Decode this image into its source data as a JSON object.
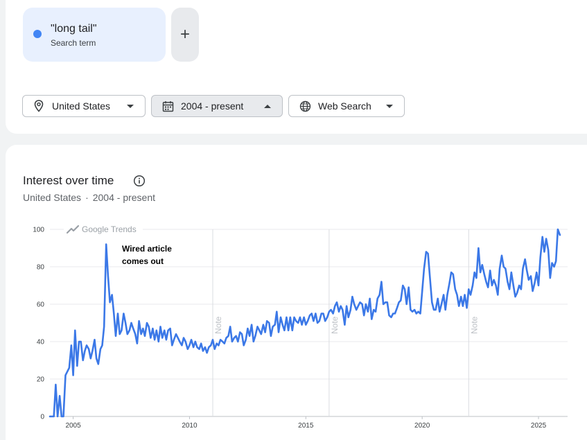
{
  "compare": {
    "term": "\"long tail\"",
    "term_type": "Search term",
    "term_color": "#4285f4",
    "add_label": "+"
  },
  "filters": {
    "region": "United States",
    "time": "2004 - present",
    "property": "Web Search",
    "icons": [
      "location-pin-icon",
      "calendar-icon",
      "globe-icon"
    ]
  },
  "panel": {
    "title": "Interest over time",
    "subtitle_region": "United States",
    "subtitle_sep": "·",
    "subtitle_time": "2004 - present",
    "watermark": "Google Trends"
  },
  "chart_data": {
    "type": "line",
    "xlabel": "",
    "ylabel": "",
    "ylim": [
      0,
      100
    ],
    "yticks": [
      0,
      20,
      40,
      60,
      80,
      100
    ],
    "xticks": [
      2005,
      2010,
      2015,
      2020,
      2025
    ],
    "xlim": [
      2004.0,
      2026.25
    ],
    "line_color": "#3b78e7",
    "grid": true,
    "notes": [
      {
        "x": 2011.0,
        "label": "Note"
      },
      {
        "x": 2016.0,
        "label": "Note"
      },
      {
        "x": 2022.0,
        "label": "Note"
      }
    ],
    "annotation": {
      "lines": [
        "Wired article",
        "comes out"
      ],
      "x": 2006.5
    },
    "series": [
      {
        "values": [
          [
            2004.0,
            0
          ],
          [
            2004.17,
            0
          ],
          [
            2004.25,
            17
          ],
          [
            2004.33,
            0
          ],
          [
            2004.42,
            11
          ],
          [
            2004.5,
            0
          ],
          [
            2004.58,
            0
          ],
          [
            2004.67,
            22
          ],
          [
            2004.75,
            24
          ],
          [
            2004.83,
            26
          ],
          [
            2004.92,
            38
          ],
          [
            2005.0,
            22
          ],
          [
            2005.08,
            46
          ],
          [
            2005.17,
            27
          ],
          [
            2005.25,
            40
          ],
          [
            2005.33,
            40
          ],
          [
            2005.42,
            30
          ],
          [
            2005.5,
            35
          ],
          [
            2005.58,
            38
          ],
          [
            2005.67,
            36
          ],
          [
            2005.75,
            31
          ],
          [
            2005.83,
            35
          ],
          [
            2005.92,
            41
          ],
          [
            2006.0,
            31
          ],
          [
            2006.08,
            28
          ],
          [
            2006.17,
            36
          ],
          [
            2006.25,
            38
          ],
          [
            2006.33,
            48
          ],
          [
            2006.42,
            92
          ],
          [
            2006.5,
            75
          ],
          [
            2006.58,
            61
          ],
          [
            2006.67,
            65
          ],
          [
            2006.75,
            55
          ],
          [
            2006.83,
            43
          ],
          [
            2006.92,
            55
          ],
          [
            2007.0,
            44
          ],
          [
            2007.08,
            46
          ],
          [
            2007.17,
            55
          ],
          [
            2007.25,
            50
          ],
          [
            2007.33,
            44
          ],
          [
            2007.42,
            46
          ],
          [
            2007.5,
            50
          ],
          [
            2007.58,
            47
          ],
          [
            2007.67,
            44
          ],
          [
            2007.75,
            39
          ],
          [
            2007.83,
            51
          ],
          [
            2007.92,
            44
          ],
          [
            2008.0,
            47
          ],
          [
            2008.08,
            43
          ],
          [
            2008.17,
            50
          ],
          [
            2008.25,
            48
          ],
          [
            2008.33,
            42
          ],
          [
            2008.42,
            47
          ],
          [
            2008.5,
            41
          ],
          [
            2008.58,
            46
          ],
          [
            2008.67,
            40
          ],
          [
            2008.75,
            48
          ],
          [
            2008.83,
            42
          ],
          [
            2008.92,
            46
          ],
          [
            2009.0,
            41
          ],
          [
            2009.08,
            46
          ],
          [
            2009.17,
            47
          ],
          [
            2009.25,
            38
          ],
          [
            2009.33,
            41
          ],
          [
            2009.42,
            44
          ],
          [
            2009.5,
            42
          ],
          [
            2009.58,
            40
          ],
          [
            2009.67,
            38
          ],
          [
            2009.75,
            42
          ],
          [
            2009.83,
            40
          ],
          [
            2009.92,
            36
          ],
          [
            2010.0,
            38
          ],
          [
            2010.08,
            41
          ],
          [
            2010.17,
            37
          ],
          [
            2010.25,
            40
          ],
          [
            2010.33,
            37
          ],
          [
            2010.42,
            36
          ],
          [
            2010.5,
            39
          ],
          [
            2010.58,
            35
          ],
          [
            2010.67,
            37
          ],
          [
            2010.75,
            34
          ],
          [
            2010.83,
            37
          ],
          [
            2010.92,
            38
          ],
          [
            2011.0,
            41
          ],
          [
            2011.08,
            36
          ],
          [
            2011.17,
            39
          ],
          [
            2011.25,
            38
          ],
          [
            2011.33,
            41
          ],
          [
            2011.42,
            40
          ],
          [
            2011.5,
            39
          ],
          [
            2011.58,
            42
          ],
          [
            2011.67,
            43
          ],
          [
            2011.75,
            48
          ],
          [
            2011.83,
            40
          ],
          [
            2011.92,
            42
          ],
          [
            2012.0,
            43
          ],
          [
            2012.08,
            40
          ],
          [
            2012.17,
            45
          ],
          [
            2012.25,
            44
          ],
          [
            2012.33,
            38
          ],
          [
            2012.42,
            41
          ],
          [
            2012.5,
            47
          ],
          [
            2012.58,
            43
          ],
          [
            2012.67,
            49
          ],
          [
            2012.75,
            40
          ],
          [
            2012.83,
            43
          ],
          [
            2012.92,
            48
          ],
          [
            2013.0,
            46
          ],
          [
            2013.08,
            44
          ],
          [
            2013.17,
            49
          ],
          [
            2013.25,
            45
          ],
          [
            2013.33,
            51
          ],
          [
            2013.42,
            50
          ],
          [
            2013.5,
            43
          ],
          [
            2013.58,
            48
          ],
          [
            2013.67,
            49
          ],
          [
            2013.75,
            56
          ],
          [
            2013.83,
            45
          ],
          [
            2013.92,
            53
          ],
          [
            2014.0,
            49
          ],
          [
            2014.08,
            46
          ],
          [
            2014.17,
            53
          ],
          [
            2014.25,
            46
          ],
          [
            2014.33,
            53
          ],
          [
            2014.42,
            46
          ],
          [
            2014.5,
            53
          ],
          [
            2014.58,
            51
          ],
          [
            2014.67,
            50
          ],
          [
            2014.75,
            53
          ],
          [
            2014.83,
            49
          ],
          [
            2014.92,
            53
          ],
          [
            2015.0,
            49
          ],
          [
            2015.08,
            51
          ],
          [
            2015.17,
            54
          ],
          [
            2015.25,
            55
          ],
          [
            2015.33,
            51
          ],
          [
            2015.42,
            55
          ],
          [
            2015.5,
            50
          ],
          [
            2015.58,
            51
          ],
          [
            2015.67,
            55
          ],
          [
            2015.75,
            55
          ],
          [
            2015.83,
            51
          ],
          [
            2015.92,
            53
          ],
          [
            2016.0,
            56
          ],
          [
            2016.08,
            57
          ],
          [
            2016.17,
            55
          ],
          [
            2016.25,
            59
          ],
          [
            2016.33,
            61
          ],
          [
            2016.42,
            56
          ],
          [
            2016.5,
            59
          ],
          [
            2016.58,
            57
          ],
          [
            2016.67,
            49
          ],
          [
            2016.75,
            59
          ],
          [
            2016.83,
            53
          ],
          [
            2016.92,
            57
          ],
          [
            2017.0,
            64
          ],
          [
            2017.08,
            60
          ],
          [
            2017.17,
            57
          ],
          [
            2017.25,
            59
          ],
          [
            2017.33,
            61
          ],
          [
            2017.42,
            60
          ],
          [
            2017.5,
            54
          ],
          [
            2017.58,
            60
          ],
          [
            2017.67,
            56
          ],
          [
            2017.75,
            63
          ],
          [
            2017.83,
            52
          ],
          [
            2017.92,
            57
          ],
          [
            2018.0,
            56
          ],
          [
            2018.08,
            63
          ],
          [
            2018.17,
            65
          ],
          [
            2018.25,
            72
          ],
          [
            2018.33,
            60
          ],
          [
            2018.42,
            61
          ],
          [
            2018.5,
            61
          ],
          [
            2018.58,
            54
          ],
          [
            2018.67,
            53
          ],
          [
            2018.75,
            55
          ],
          [
            2018.83,
            55
          ],
          [
            2018.92,
            58
          ],
          [
            2019.0,
            61
          ],
          [
            2019.08,
            62
          ],
          [
            2019.17,
            70
          ],
          [
            2019.25,
            68
          ],
          [
            2019.33,
            60
          ],
          [
            2019.42,
            69
          ],
          [
            2019.5,
            57
          ],
          [
            2019.58,
            56
          ],
          [
            2019.67,
            57
          ],
          [
            2019.75,
            55
          ],
          [
            2019.83,
            56
          ],
          [
            2019.92,
            55
          ],
          [
            2020.0,
            67
          ],
          [
            2020.08,
            79
          ],
          [
            2020.17,
            88
          ],
          [
            2020.25,
            87
          ],
          [
            2020.33,
            75
          ],
          [
            2020.42,
            61
          ],
          [
            2020.5,
            57
          ],
          [
            2020.58,
            57
          ],
          [
            2020.67,
            63
          ],
          [
            2020.75,
            56
          ],
          [
            2020.83,
            60
          ],
          [
            2020.92,
            65
          ],
          [
            2021.0,
            57
          ],
          [
            2021.08,
            65
          ],
          [
            2021.17,
            71
          ],
          [
            2021.25,
            77
          ],
          [
            2021.33,
            76
          ],
          [
            2021.42,
            68
          ],
          [
            2021.5,
            65
          ],
          [
            2021.58,
            59
          ],
          [
            2021.67,
            64
          ],
          [
            2021.75,
            59
          ],
          [
            2021.83,
            65
          ],
          [
            2021.92,
            58
          ],
          [
            2022.0,
            68
          ],
          [
            2022.08,
            65
          ],
          [
            2022.17,
            70
          ],
          [
            2022.25,
            77
          ],
          [
            2022.33,
            74
          ],
          [
            2022.42,
            90
          ],
          [
            2022.5,
            77
          ],
          [
            2022.58,
            81
          ],
          [
            2022.67,
            76
          ],
          [
            2022.75,
            72
          ],
          [
            2022.83,
            69
          ],
          [
            2022.92,
            78
          ],
          [
            2023.0,
            70
          ],
          [
            2023.08,
            73
          ],
          [
            2023.17,
            70
          ],
          [
            2023.25,
            65
          ],
          [
            2023.33,
            79
          ],
          [
            2023.42,
            86
          ],
          [
            2023.5,
            80
          ],
          [
            2023.58,
            79
          ],
          [
            2023.67,
            72
          ],
          [
            2023.75,
            68
          ],
          [
            2023.83,
            77
          ],
          [
            2023.92,
            70
          ],
          [
            2024.0,
            64
          ],
          [
            2024.08,
            66
          ],
          [
            2024.17,
            70
          ],
          [
            2024.25,
            68
          ],
          [
            2024.33,
            79
          ],
          [
            2024.42,
            84
          ],
          [
            2024.5,
            78
          ],
          [
            2024.58,
            73
          ],
          [
            2024.67,
            75
          ],
          [
            2024.75,
            67
          ],
          [
            2024.83,
            71
          ],
          [
            2024.92,
            77
          ],
          [
            2025.0,
            70
          ],
          [
            2025.08,
            85
          ],
          [
            2025.17,
            96
          ],
          [
            2025.25,
            88
          ],
          [
            2025.33,
            95
          ],
          [
            2025.42,
            89
          ],
          [
            2025.5,
            74
          ],
          [
            2025.58,
            82
          ],
          [
            2025.67,
            80
          ],
          [
            2025.75,
            83
          ],
          [
            2025.83,
            100
          ],
          [
            2025.92,
            97
          ]
        ]
      }
    ]
  }
}
